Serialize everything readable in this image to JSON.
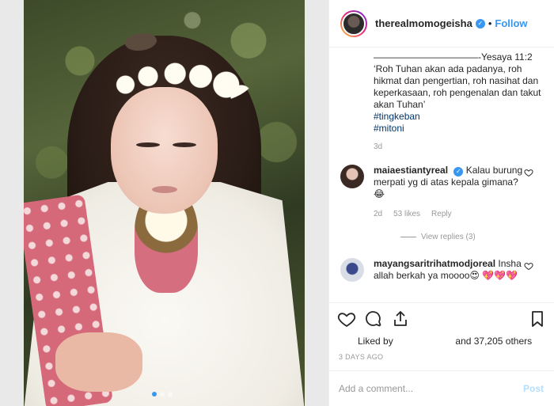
{
  "post": {
    "username": "therealmomogeisha",
    "follow_label": "Follow",
    "separator": "•",
    "caption_text": "———————————-Yesaya 11:2 ‘Roh Tuhan akan ada padanya, roh hikmat dan pengertian, roh nasihat dan keperkasaan, roh pengenalan dan takut akan Tuhan’",
    "hashtags": [
      "#tingkeban",
      "#mitoni"
    ],
    "caption_time": "3d"
  },
  "comments": [
    {
      "username": "maiaestiantyreal",
      "text": "Kalau burung merpati yg di atas kepala gimana? 😂",
      "time": "2d",
      "likes": "53 likes",
      "reply": "Reply"
    },
    {
      "username": "mayangsaritrihatmodjoreal",
      "text": "Insha allah berkah ya moooo😍 💖💖💖"
    }
  ],
  "view_replies": "View replies (3)",
  "likes": {
    "prefix": "Liked by",
    "suffix": "and 37,205 others"
  },
  "post_date": "3 DAYS AGO",
  "add_comment_placeholder": "Add a comment...",
  "post_button": "Post",
  "colors": {
    "link": "#3897f0",
    "hashtag": "#003569",
    "muted": "#999999",
    "verified": "#3897f0"
  },
  "icons": [
    "heart-icon",
    "comment-icon",
    "share-icon",
    "bookmark-icon",
    "verified-badge-icon"
  ]
}
